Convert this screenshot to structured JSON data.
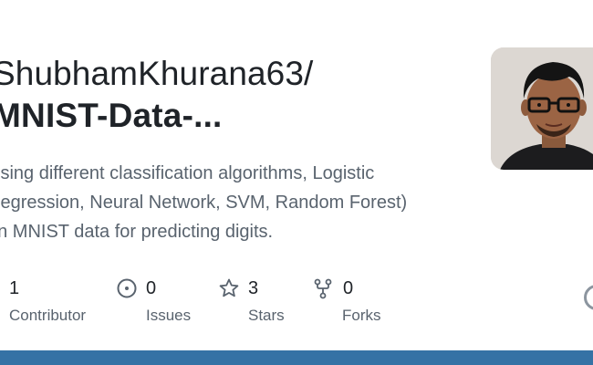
{
  "repo": {
    "owner": "ShubhamKhurana63/",
    "name": "MNIST-Data-...",
    "description_lines": [
      "Using different classification algorithms, Logistic",
      "Regression, Neural Network, SVM, Random Forest)",
      "on MNIST data for predicting digits."
    ]
  },
  "stats": {
    "contributors": {
      "count": "1",
      "label": "Contributor",
      "icon": "people-icon"
    },
    "issues": {
      "count": "0",
      "label": "Issues",
      "icon": "issue-opened-icon"
    },
    "stars": {
      "count": "3",
      "label": "Stars",
      "icon": "star-icon"
    },
    "forks": {
      "count": "0",
      "label": "Forks",
      "icon": "repo-forked-icon"
    }
  },
  "colors": {
    "language_bar": "#3572a5",
    "text_primary": "#1f2328",
    "text_muted": "#59636e"
  }
}
